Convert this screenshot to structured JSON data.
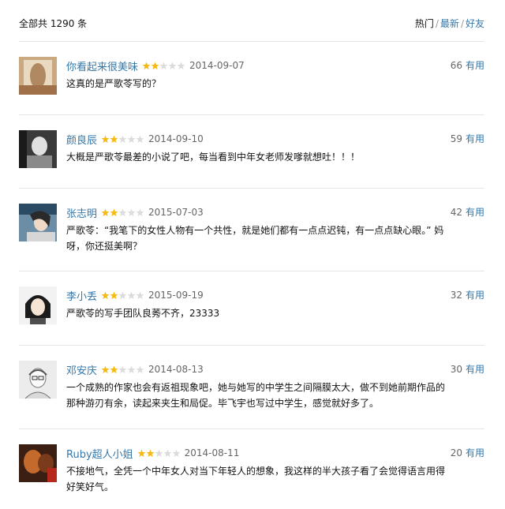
{
  "header": {
    "total": "全部共 1290 条",
    "sort_hot": "热门",
    "sort_new": "最新",
    "sort_friends": "好友",
    "separator": "/"
  },
  "colors": {
    "link": "#3377aa",
    "star_on": "#f5b90f",
    "star_off": "#dcdcdc"
  },
  "reviews": [
    {
      "user": "你看起来很美味",
      "rating": 2,
      "date": "2014-09-07",
      "votes": "66",
      "vote_label": "有用",
      "text": "这真的是严歌苓写的？"
    },
    {
      "user": "颜良辰",
      "rating": 2,
      "date": "2014-09-10",
      "votes": "59",
      "vote_label": "有用",
      "text": "大概是严歌苓最差的小说了吧，每当看到中年女老师发嗲就想吐！！！"
    },
    {
      "user": "张志明",
      "rating": 2,
      "date": "2015-07-03",
      "votes": "42",
      "vote_label": "有用",
      "text": "严歌苓：“我笔下的女性人物有一个共性，就是她们都有一点点迟钝，有一点点缺心眼。” 妈呀，你还挺美啊？"
    },
    {
      "user": "李小丢",
      "rating": 2,
      "date": "2015-09-19",
      "votes": "32",
      "vote_label": "有用",
      "text": "严歌苓的写手团队良莠不齐，23333"
    },
    {
      "user": "邓安庆",
      "rating": 2,
      "date": "2014-08-13",
      "votes": "30",
      "vote_label": "有用",
      "text": "一个成熟的作家也会有返祖现象吧，她与她写的中学生之间隔膜太大，做不到她前期作品的那种游刃有余，读起来夹生和局促。毕飞宇也写过中学生，感觉就好多了。"
    },
    {
      "user": "Ruby超人小姐",
      "rating": 2,
      "date": "2014-08-11",
      "votes": "20",
      "vote_label": "有用",
      "text": "不接地气，全凭一个中年女人对当下年轻人的想象，我这样的半大孩子看了会觉得语言用得好笑好气。"
    }
  ]
}
